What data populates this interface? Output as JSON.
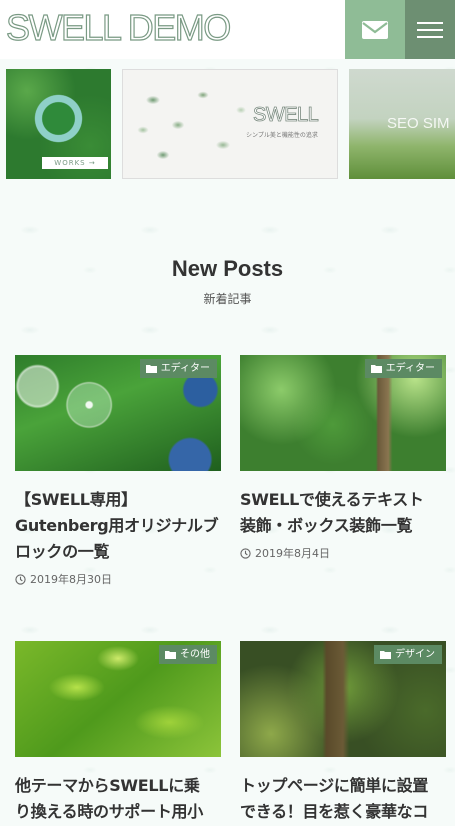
{
  "header": {
    "logo": "SWELL DEMO",
    "mail_icon": "mail-icon",
    "menu_icon": "hamburger-icon"
  },
  "slider": {
    "slides": [
      {
        "label": "WORKS →"
      },
      {
        "brand": "SWELL",
        "tagline": "シンプル美と機能性の追求"
      },
      {
        "text": "SEO SIM"
      }
    ]
  },
  "section": {
    "title": "New Posts",
    "subtitle": "新着記事"
  },
  "posts": [
    {
      "category": "エディター",
      "title_line1": "【SWELL専用】",
      "title_line2": "Gutenberg用オリジナルブ",
      "title_line3": "ロックの一覧",
      "date": "2019年8月30日"
    },
    {
      "category": "エディター",
      "title_line1": "SWELLで使えるテキスト",
      "title_line2": "装飾・ボックス装飾一覧",
      "date": "2019年8月4日"
    },
    {
      "category": "その他",
      "title_line1": "他テーマからSWELLに乗",
      "title_line2": "り換える時のサポート用小"
    },
    {
      "category": "デザイン",
      "title_line1": "トップページに簡単に設置",
      "title_line2": "できる！目を惹く豪華なコ"
    }
  ],
  "colors": {
    "accent": "#5c8a63",
    "mail_button": "#8fbc96",
    "menu_button": "#6d8f72"
  }
}
